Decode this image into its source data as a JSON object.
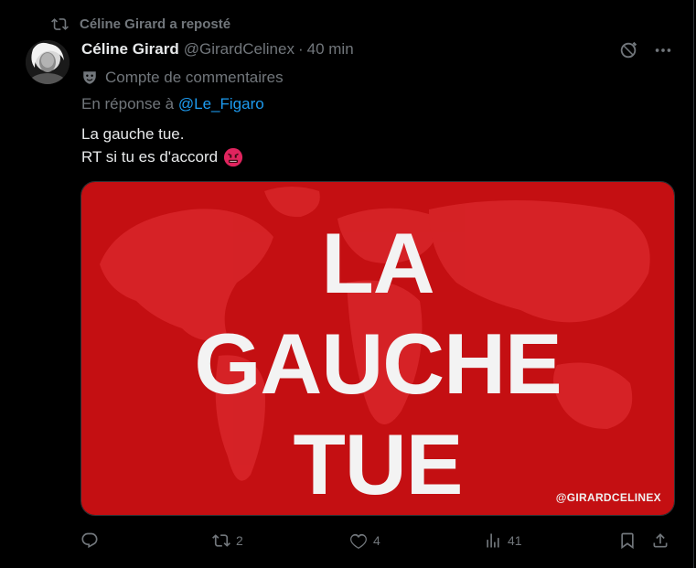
{
  "repost": {
    "text": "Céline Girard a reposté",
    "icon": "repost-icon"
  },
  "author": {
    "name": "Céline Girard",
    "handle": "@GirardCelinex",
    "separator": "·",
    "time": "40 min"
  },
  "account_label": {
    "icon": "theater-mask-icon",
    "text": "Compte de commentaires"
  },
  "reply": {
    "prefix": "En réponse à",
    "mention": "@Le_Figaro"
  },
  "tweet": {
    "line1": "La gauche tue.",
    "line2": "RT si tu es d'accord",
    "emoji": "angry-face-icon"
  },
  "media": {
    "line1": "LA",
    "line2": "GAUCHE",
    "line3": "TUE",
    "watermark": "@GIRARDCELINEX",
    "colors": {
      "background": "#c40f12",
      "map": "#d9262a"
    }
  },
  "actions": {
    "replies": "",
    "reposts": "2",
    "likes": "4",
    "views": "41"
  },
  "colors": {
    "accent": "#1d9bf0",
    "muted": "#71767b",
    "text": "#e7e9ea"
  }
}
